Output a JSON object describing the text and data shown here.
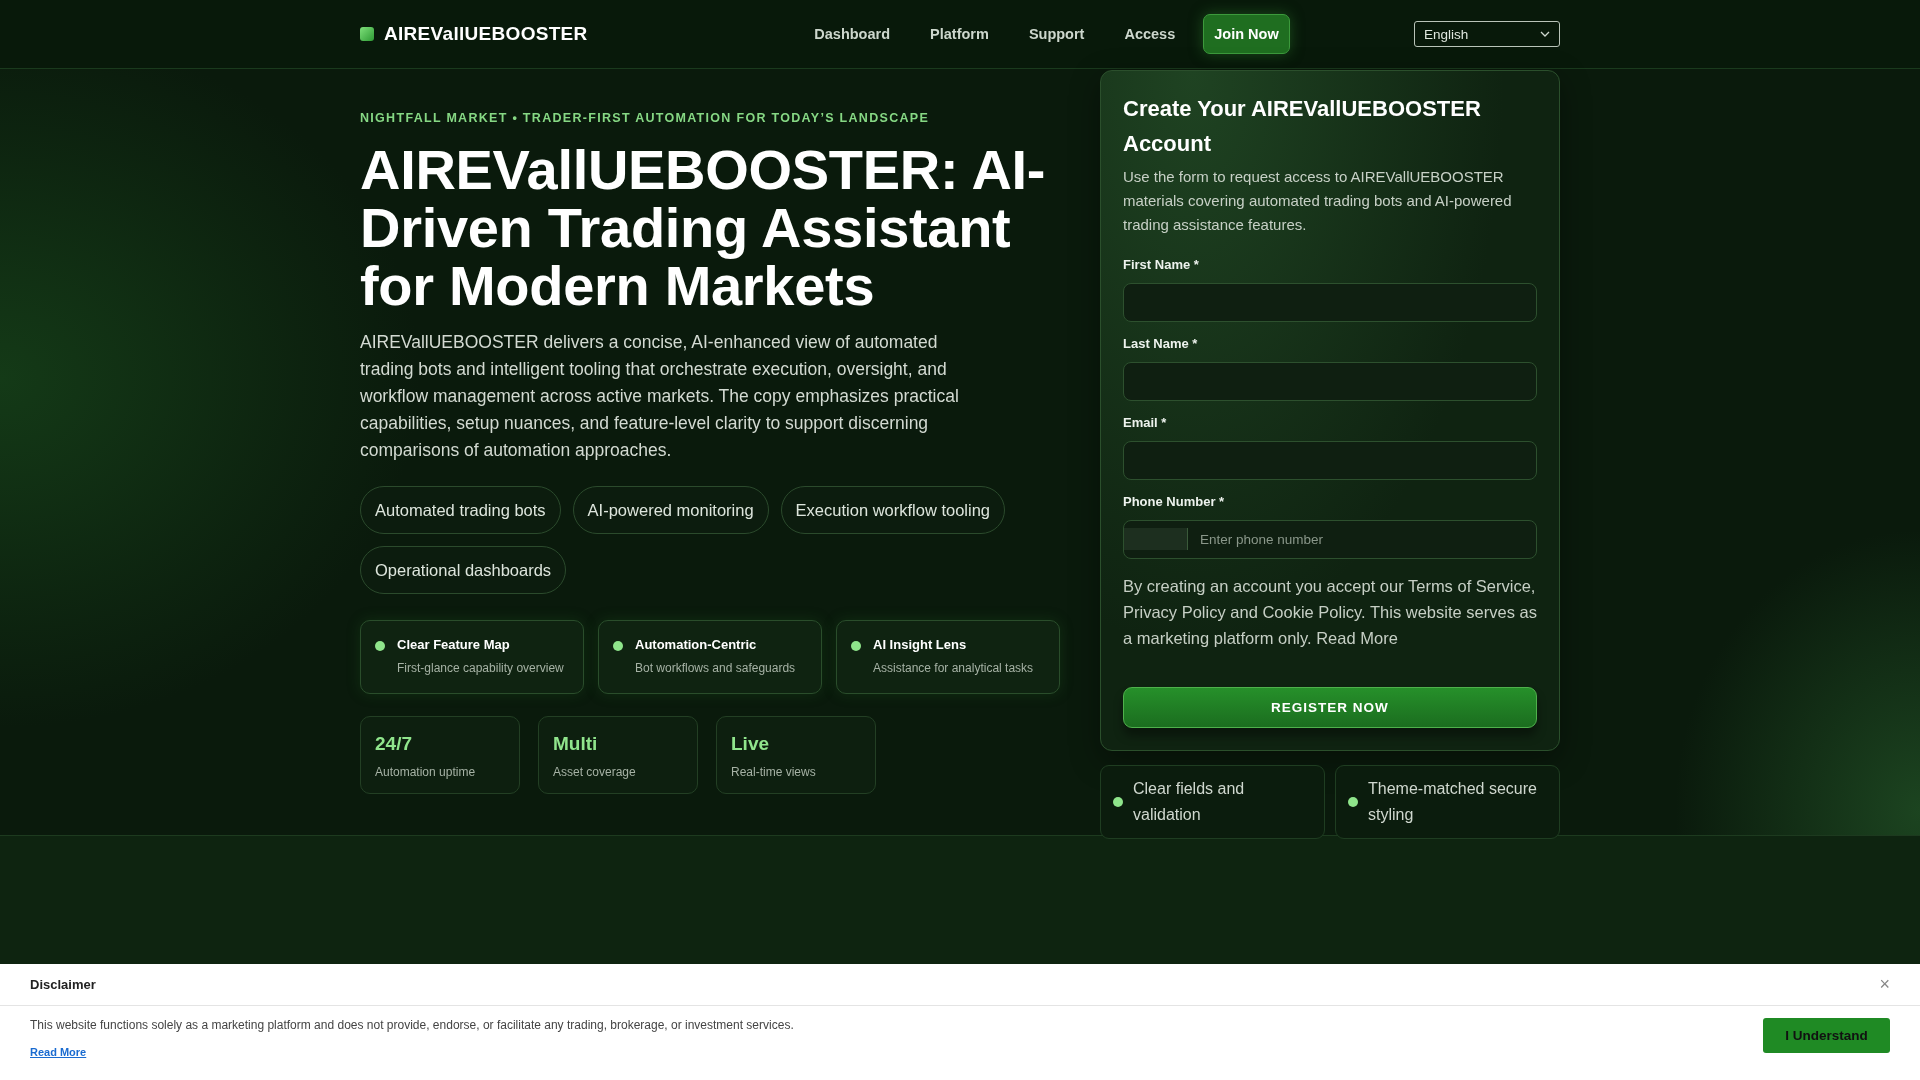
{
  "header": {
    "logo": "AIREVallUEBOOSTER",
    "nav": [
      {
        "label": "Dashboard",
        "kind": "link"
      },
      {
        "label": "Platform",
        "kind": "link"
      },
      {
        "label": "Support",
        "kind": "link"
      },
      {
        "label": "Access",
        "kind": "link"
      },
      {
        "label": "Join Now",
        "kind": "button"
      }
    ],
    "language": "English"
  },
  "hero": {
    "eyebrow": "NIGHTFALL MARKET • TRADER-FIRST AUTOMATION FOR TODAY’S LANDSCAPE",
    "title": "AIREVallUEBOOSTER: AI-Driven Trading Assistant for Modern Markets",
    "description": "AIREVallUEBOOSTER delivers a concise, AI-enhanced view of automated trading bots and intelligent tooling that orchestrate execution, oversight, and workflow management across active markets. The copy emphasizes practical capabilities, setup nuances, and feature-level clarity to support discerning comparisons of automation approaches.",
    "chips": [
      "Automated trading bots",
      "AI-powered monitoring",
      "Execution workflow tooling",
      "Operational dashboards"
    ],
    "features": [
      {
        "title": "Clear Feature Map",
        "subtitle": "First-glance capability overview"
      },
      {
        "title": "Automation-Centric",
        "subtitle": "Bot workflows and safeguards"
      },
      {
        "title": "AI Insight Lens",
        "subtitle": "Assistance for analytical tasks"
      }
    ],
    "stats": [
      {
        "value": "24/7",
        "label": "Automation uptime"
      },
      {
        "value": "Multi",
        "label": "Asset coverage"
      },
      {
        "value": "Live",
        "label": "Real-time views"
      }
    ]
  },
  "form": {
    "title": "Create Your AIREVallUEBOOSTER Account",
    "description": "Use the form to request access to AIREVallUEBOOSTER materials covering automated trading bots and AI-powered trading assistance features.",
    "fields": [
      {
        "label": "First Name *",
        "kind": "text"
      },
      {
        "label": "Last Name *",
        "kind": "text"
      },
      {
        "label": "Email *",
        "kind": "text"
      },
      {
        "label": "Phone Number *",
        "kind": "phone",
        "placeholder": "Enter phone number"
      }
    ],
    "consent": "By creating an account you accept our Terms of Service, Privacy Policy and Cookie Policy. This website serves as a marketing platform only. Read More",
    "submit": "REGISTER NOW"
  },
  "form_notes": [
    "Clear fields and validation",
    "Theme-matched secure styling"
  ],
  "disclaimer": {
    "title": "Disclaimer",
    "close": "×",
    "text": "This website functions solely as a marketing platform and does not provide, endorse, or facilitate any trading, brokerage, or investment services.",
    "link": "Read More",
    "button": "I Understand"
  }
}
